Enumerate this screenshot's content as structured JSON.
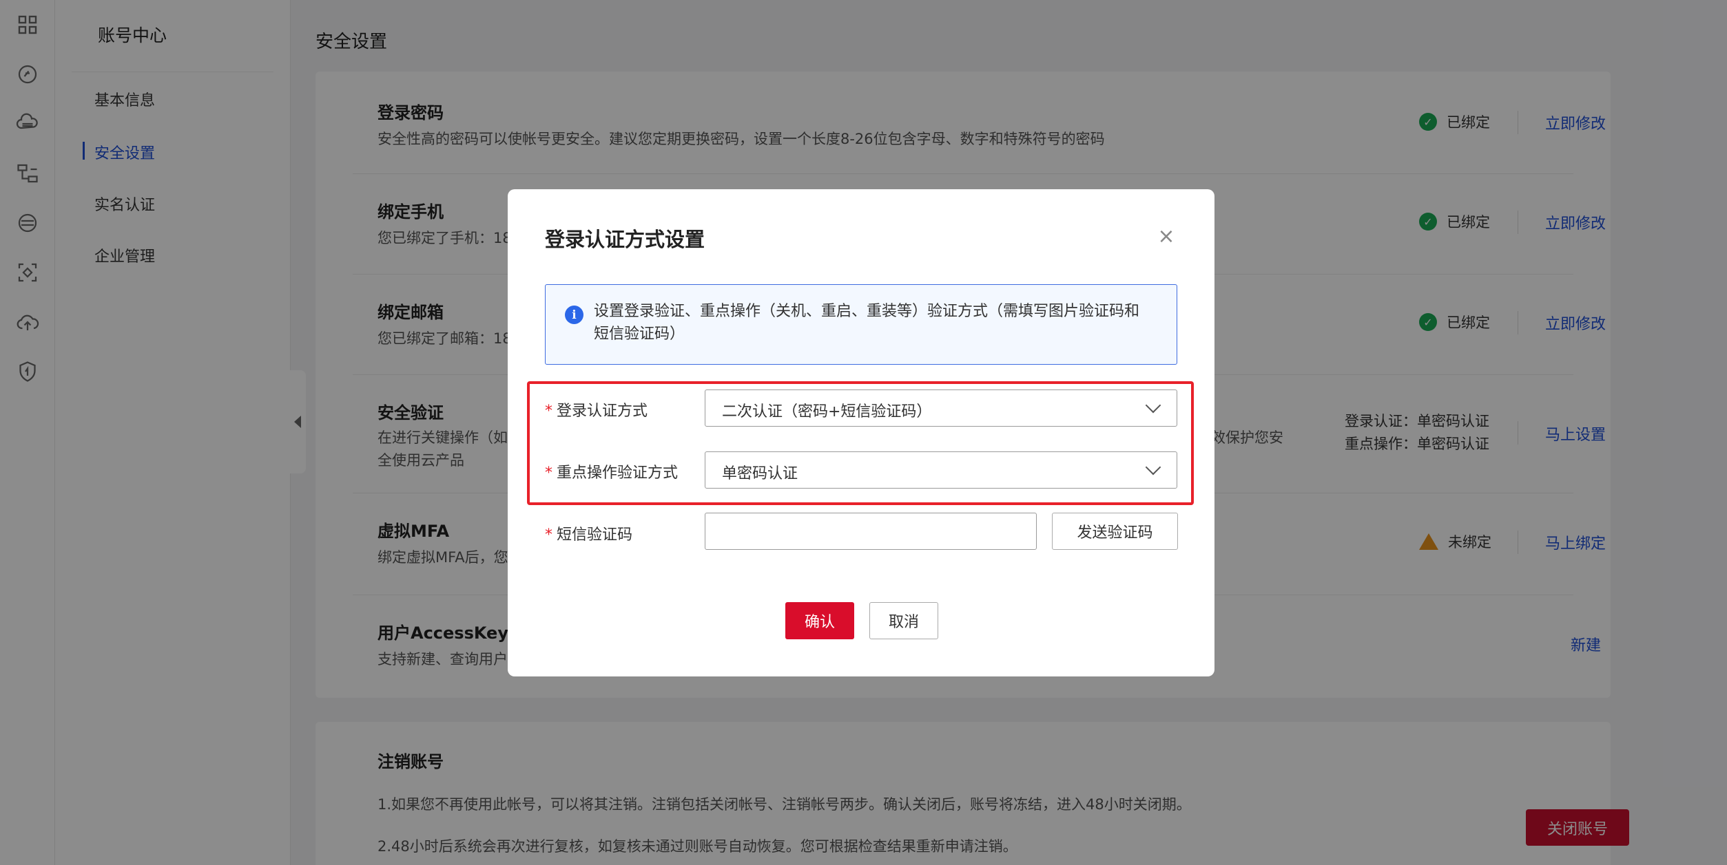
{
  "nav": {
    "icons": [
      "grid-icon",
      "speed-icon",
      "cloud-server-icon",
      "network-icon",
      "storage-icon",
      "container-icon",
      "cloud-upload-icon",
      "shield-icon"
    ]
  },
  "subnav": {
    "title": "账号中心",
    "items": [
      {
        "label": "基本信息"
      },
      {
        "label": "安全设置"
      },
      {
        "label": "实名认证"
      },
      {
        "label": "企业管理"
      }
    ]
  },
  "main": {
    "title": "安全设置",
    "rows": [
      {
        "title": "登录密码",
        "desc": "安全性高的密码可以使帐号更安全。建议您定期更换密码，设置一个长度8-26位包含字母、数字和特殊符号的密码",
        "status": "已绑定",
        "action": "立即修改"
      },
      {
        "title": "绑定手机",
        "desc": "您已绑定了手机：18",
        "status": "已绑定",
        "action": "立即修改"
      },
      {
        "title": "绑定邮箱",
        "desc": "您已绑定了邮箱：18",
        "status": "已绑定",
        "action": "立即修改"
      },
      {
        "title": "安全验证",
        "desc_line1": "在进行关键操作（如",
        "desc_line1_tail": "效保护您安",
        "desc_line2": "全使用云产品",
        "side_line1": "登录认证：单密码认证",
        "side_line2": "重点操作：单密码认证",
        "action": "马上设置"
      },
      {
        "title": "虚拟MFA",
        "desc": "绑定虚拟MFA后，您",
        "status": "未绑定",
        "action": "马上绑定"
      },
      {
        "title": "用户AccessKey",
        "desc": "支持新建、查询用户",
        "action": "新建"
      }
    ]
  },
  "cancel_account": {
    "title": "注销账号",
    "line1": "1.如果您不再使用此帐号，可以将其注销。注销包括关闭帐号、注销帐号两步。确认关闭后，账号将冻结，进入48小时关闭期。",
    "line2": "2.48小时后系统会再次进行复核，如复核未通过则账号自动恢复。您可根据检查结果重新申请注销。",
    "button": "关闭账号"
  },
  "modal": {
    "title": "登录认证方式设置",
    "close_icon": "close-icon",
    "info_line1": "设置登录验证、重点操作（关机、重启、重装等）验证方式（需填写图片验证码和",
    "info_line2": "短信验证码）",
    "required_mark": "*",
    "login_auth_label": "登录认证方式",
    "login_auth_value": "二次认证（密码+短信验证码）",
    "key_op_label": "重点操作验证方式",
    "key_op_value": "单密码认证",
    "sms_label": "短信验证码",
    "sms_placeholder": "",
    "send_code": "发送验证码",
    "confirm": "确认",
    "cancel": "取消"
  },
  "colors": {
    "accent": "#1f4fd6",
    "danger": "#d90d2b",
    "success": "#1aaa55",
    "warning": "#e8931c"
  }
}
